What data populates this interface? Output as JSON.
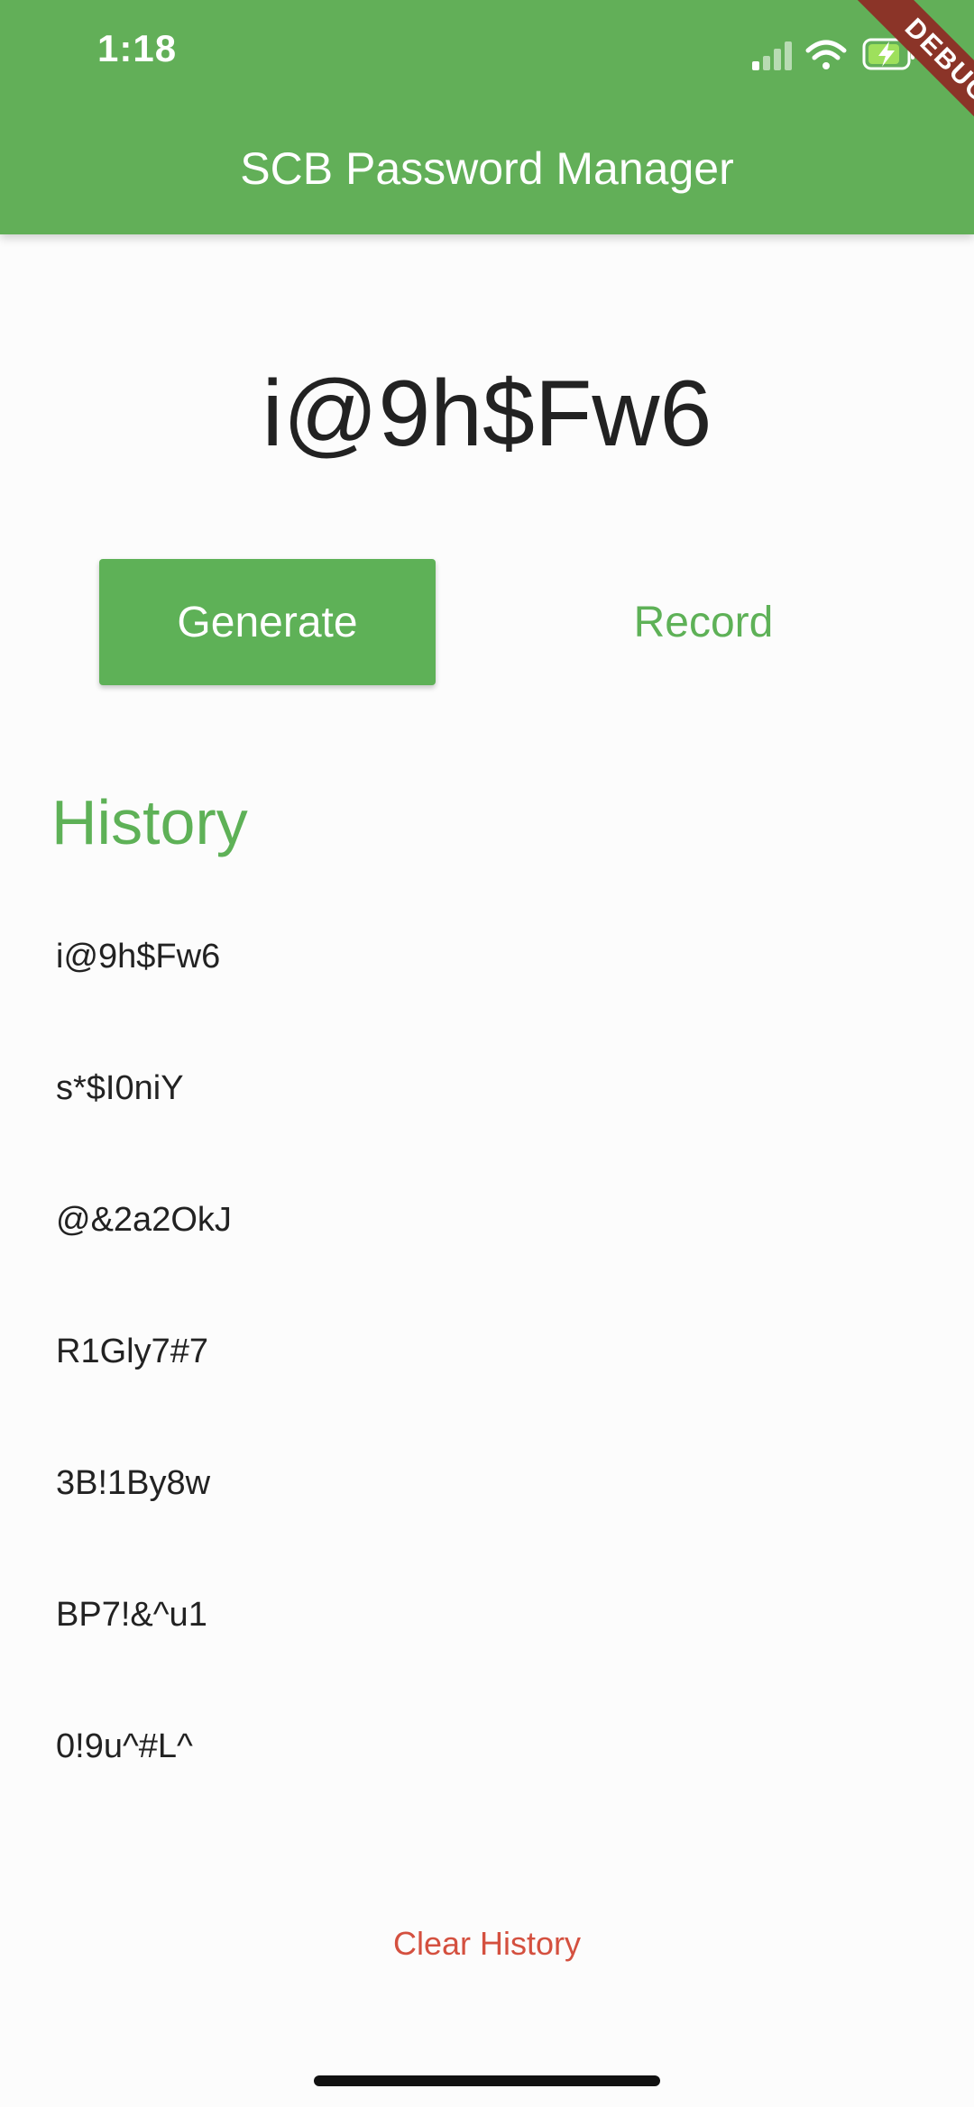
{
  "status_bar": {
    "time": "1:18",
    "icons": [
      "signal-icon",
      "wifi-icon",
      "battery-charging-icon"
    ]
  },
  "app_bar": {
    "title": "SCB Password Manager",
    "color": "#62af58"
  },
  "debug_banner": "DEBUG",
  "current_password": "i@9h$Fw6",
  "buttons": {
    "generate": "Generate",
    "record": "Record",
    "clear_history": "Clear History"
  },
  "history": {
    "heading": "History",
    "items": [
      "i@9h$Fw6",
      "s*$I0niY",
      "@&2a2OkJ",
      "R1Gly7#7",
      "3B!1By8w",
      "BP7!&^u1",
      "0!9u^#L^"
    ]
  },
  "colors": {
    "accent": "#5eb157",
    "danger": "#d4503f"
  }
}
